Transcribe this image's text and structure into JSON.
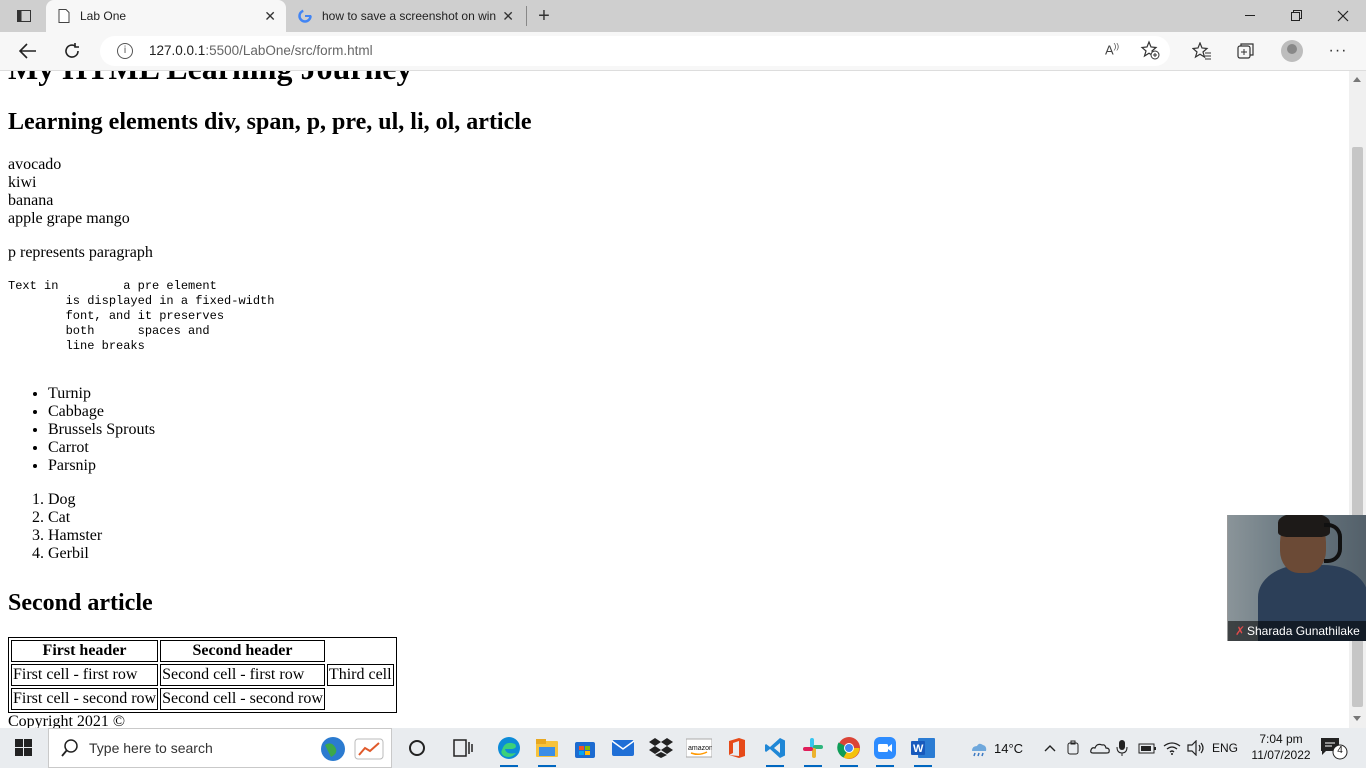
{
  "browser": {
    "tabs": [
      {
        "title": "Lab One",
        "active": true
      },
      {
        "title": "how to save a screenshot on win",
        "active": false
      }
    ],
    "url_host": "127.0.0.1",
    "url_path": ":5500/LabOne/src/form.html",
    "icons": [
      "tab-actions-icon",
      "page-icon",
      "google-icon",
      "close-icon",
      "new-tab-icon",
      "minimize-icon",
      "restore-icon",
      "window-close-icon",
      "back-icon",
      "refresh-icon",
      "info-icon",
      "read-aloud-icon",
      "add-favorite-icon",
      "favorites-icon",
      "collections-icon",
      "profile-icon",
      "more-icon"
    ]
  },
  "page": {
    "h1": "My HTML Learning Journey",
    "h2_first": "Learning elements div, span, p, pre, ul, li, ol, article",
    "divs": [
      "avocado",
      "kiwi",
      "banana"
    ],
    "spans": [
      "apple",
      "grape",
      "mango"
    ],
    "paragraph": "p represents paragraph",
    "pre_text": "Text in         a pre element\n        is displayed in a fixed-width\n        font, and it preserves\n        both      spaces and\n        line breaks",
    "ul_items": [
      "Turnip",
      "Cabbage",
      "Brussels Sprouts",
      "Carrot",
      "Parsnip"
    ],
    "ol_items": [
      "Dog",
      "Cat",
      "Hamster",
      "Gerbil"
    ],
    "h2_second": "Second article",
    "table": {
      "headers": [
        "First header",
        "Second header"
      ],
      "rows": [
        [
          "First cell - first row",
          "Second cell - first row",
          "Third cell"
        ],
        [
          "First cell - second row",
          "Second cell - second row"
        ]
      ]
    },
    "footer": "Copyright 2021 ©"
  },
  "video": {
    "name": "Sharada Gunathilake"
  },
  "taskbar": {
    "search_placeholder": "Type here to search",
    "weather": "14°C",
    "language": "ENG",
    "time": "7:04 pm",
    "date": "11/07/2022",
    "notification_count": "4"
  }
}
